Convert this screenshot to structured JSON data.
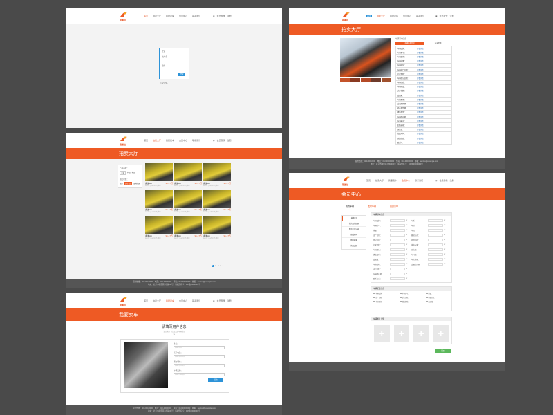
{
  "brand": {
    "name": "稳赢拍",
    "accent": "#ee5a24",
    "footer_bg": "#555555"
  },
  "nav": {
    "items": [
      "首页",
      "拍卖大厅",
      "我要卖车",
      "会员中心",
      "联系我们"
    ],
    "login": "会员登录",
    "register": "注册"
  },
  "footer": {
    "line1": "服务热线：400-000-0000　电话：010-00000000　传真：010-00000000　邮箱：service@example.com",
    "line2": "地址：北京市朝阳区示例路00号　版权所有 ©　ICP备00000000号"
  },
  "login_page": {
    "title": "登录",
    "user_label": "用户名",
    "pass_label": "密码",
    "button": "登录",
    "link": "忘记密码"
  },
  "auction_hall": {
    "banner": "拍卖大厅",
    "filter_brand_label": "汽车品牌：",
    "filter_brands": [
      "大众",
      "丰田",
      "本田"
    ],
    "filter_status_label": "拍卖状态：",
    "filter_status": [
      "全部",
      "正在拍卖",
      "即将拍卖"
    ],
    "cars": [
      {
        "name": "奥迪A5",
        "price": "¥1.47万",
        "meta": "2012年 | 3.6万公里 | 北京"
      },
      {
        "name": "奥迪A5",
        "price": "¥1.47万",
        "meta": "2012年 | 3.6万公里 | 北京"
      },
      {
        "name": "奥迪A5",
        "price": "¥1.47万",
        "meta": "2012年 | 3.6万公里 | 北京"
      },
      {
        "name": "奥迪A5",
        "price": "¥1.47万",
        "meta": "2012年 | 3.6万公里 | 北京"
      },
      {
        "name": "奥迪A5",
        "price": "¥1.47万",
        "meta": "2012年 | 3.6万公里 | 北京"
      },
      {
        "name": "奥迪A5",
        "price": "¥1.47万",
        "meta": "2012年 | 3.6万公里 | 北京"
      },
      {
        "name": "奥迪A5",
        "price": "¥1.47万",
        "meta": "2012年 | 3.6万公里 | 北京"
      },
      {
        "name": "奥迪A5",
        "price": "¥1.47万",
        "meta": "2012年 | 3.6万公里 | 北京"
      },
      {
        "name": "奥迪A5",
        "price": "¥1.47万",
        "meta": "2012年 | 3.6万公里 | 北京"
      }
    ],
    "pages": [
      "1",
      "2",
      "3",
      "4",
      "»"
    ]
  },
  "sell_page": {
    "banner": "我要卖车",
    "title": "请填写用户信息",
    "subtitle": "请完善以下信息完成车辆登记",
    "fields": [
      "姓名：",
      "联系电话：",
      "所在城市：",
      "车辆品牌："
    ],
    "placeholders": [
      "请输入姓名",
      "请输入联系电话",
      "请输入所在城市",
      "请输入车辆品牌"
    ],
    "button": "提交"
  },
  "detail_page": {
    "banner": "拍卖大厅",
    "panel_title": "车辆基本信息",
    "tabs": [
      "车辆基本信息",
      "车况检测"
    ],
    "rows": [
      {
        "k": "车辆品牌：",
        "v": "查看详情"
      },
      {
        "k": "车辆型号：",
        "v": "查看详情"
      },
      {
        "k": "车辆颜色：",
        "v": "查看详情"
      },
      {
        "k": "车辆排量：",
        "v": "查看详情"
      },
      {
        "k": "车辆年份：",
        "v": "查看详情"
      },
      {
        "k": "车辆出厂日期：",
        "v": "查看详情"
      },
      {
        "k": "行驶里程：",
        "v": "查看详情"
      },
      {
        "k": "车辆登记日期：",
        "v": "查看详情"
      },
      {
        "k": "车辆性质：",
        "v": "查看详情"
      },
      {
        "k": "车辆用途：",
        "v": "查看详情"
      },
      {
        "k": "过户次数：",
        "v": "查看详情"
      },
      {
        "k": "变速箱：",
        "v": "查看详情"
      },
      {
        "k": "年检到期：",
        "v": "查看详情"
      },
      {
        "k": "交强险到期：",
        "v": "查看详情"
      },
      {
        "k": "商业险到期：",
        "v": "查看详情"
      },
      {
        "k": "燃油类型：",
        "v": "查看详情"
      },
      {
        "k": "车辆所在地：",
        "v": "查看详情"
      },
      {
        "k": "车源编号：",
        "v": "查看详情"
      },
      {
        "k": "起拍价格：",
        "v": "查看详情"
      },
      {
        "k": "保证金：",
        "v": "查看详情"
      },
      {
        "k": "拍卖时间：",
        "v": "查看详情"
      },
      {
        "k": "竞拍状态：",
        "v": "查看详情"
      },
      {
        "k": "联系人：",
        "v": "查看详情"
      }
    ]
  },
  "member_center": {
    "banner": "会员中心",
    "tabs": [
      "我的车辆",
      "发布车辆",
      "我的订单"
    ],
    "side_menu": [
      "基本信息",
      "我的竞拍记录",
      "我的卖车记录",
      "修改密码",
      "我的收藏",
      "消息通知"
    ],
    "section1_title": "车辆基本信息",
    "left_labels": [
      "车辆品牌：",
      "车辆型号：",
      "排量：",
      "出厂日期：",
      "登记日期：",
      "行驶里程：",
      "车辆颜色：",
      "燃油类型：",
      "变速箱：",
      "车身结构：",
      "过户次数：",
      "车辆所在地：",
      "联系电话："
    ],
    "right_labels": [
      "车系：",
      "年份：",
      "车况：",
      "驱动方式：",
      "使用性质：",
      "排放标准：",
      "座位数：",
      "车门数：",
      "年检到期：",
      "交强险到期："
    ],
    "section2_title": "车辆配置信息",
    "section3_title": "车辆图片上传",
    "submit": "提交"
  }
}
